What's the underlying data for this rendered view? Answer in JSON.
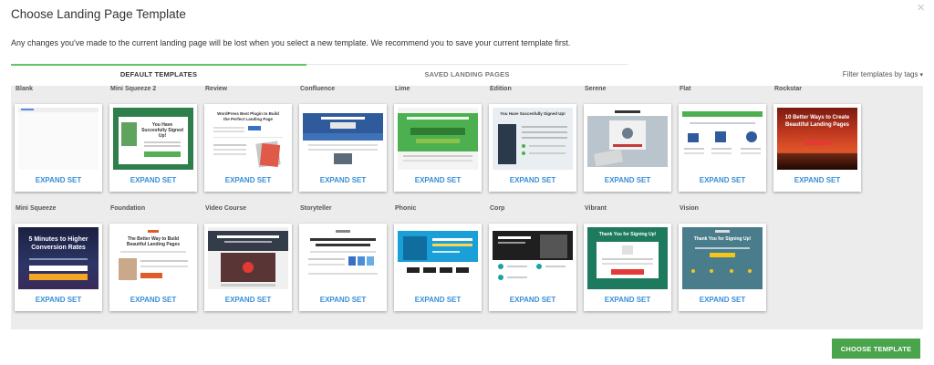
{
  "dialog": {
    "title": "Choose Landing Page Template",
    "close_symbol": "×",
    "description": "Any changes you've made to the current landing page will be lost when you select a new template. We recommend you to save your current template first."
  },
  "tabs": [
    {
      "label": "DEFAULT TEMPLATES",
      "active": true
    },
    {
      "label": "SAVED LANDING PAGES",
      "active": false
    }
  ],
  "filter": {
    "label": "Filter templates by tags",
    "icon": "chevron-down-icon"
  },
  "templates": [
    {
      "name": "Blank",
      "action": "EXPAND SET"
    },
    {
      "name": "Mini Squeeze 2",
      "action": "EXPAND SET"
    },
    {
      "name": "Review",
      "action": "EXPAND SET"
    },
    {
      "name": "Confluence",
      "action": "EXPAND SET"
    },
    {
      "name": "Lime",
      "action": "EXPAND SET"
    },
    {
      "name": "Edition",
      "action": "EXPAND SET"
    },
    {
      "name": "Serene",
      "action": "EXPAND SET"
    },
    {
      "name": "Flat",
      "action": "EXPAND SET"
    },
    {
      "name": "Rockstar",
      "action": "EXPAND SET"
    },
    {
      "name": "Mini Squeeze",
      "action": "EXPAND SET"
    },
    {
      "name": "Foundation",
      "action": "EXPAND SET"
    },
    {
      "name": "Video Course",
      "action": "EXPAND SET"
    },
    {
      "name": "Storyteller",
      "action": "EXPAND SET"
    },
    {
      "name": "Phonic",
      "action": "EXPAND SET"
    },
    {
      "name": "Corp",
      "action": "EXPAND SET"
    },
    {
      "name": "Vibrant",
      "action": "EXPAND SET"
    },
    {
      "name": "Vision",
      "action": "EXPAND SET"
    }
  ],
  "thumbnail_text": {
    "mini_squeeze_2": "You Have Succesfully Signed Up!",
    "review": "WordPress Best Plugin to Build the Perfect Landing Page",
    "edition": "You Have Succesfully Signed Up!",
    "rockstar": "10 Better Ways to Create Beautiful Landing Pages",
    "mini_squeeze": "5 Minutes to Higher Conversion Rates",
    "foundation": "The Better Way to Build Beautiful Landing Pages",
    "vibrant": "Thank You for Signing Up!",
    "vision": "Thank You for Signing Up!"
  },
  "choose_button": "CHOOSE TEMPLATE",
  "colors": {
    "accent_green": "#62c462",
    "button_green": "#4aa44c",
    "link_blue": "#3a8fd8",
    "panel_bg": "#ececec"
  }
}
